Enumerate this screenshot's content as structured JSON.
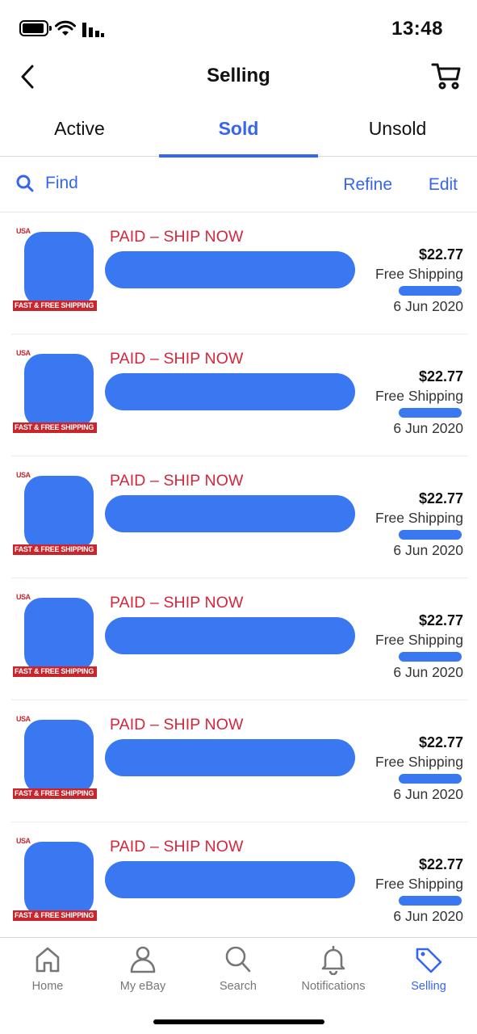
{
  "status_bar": {
    "time": "13:48"
  },
  "nav": {
    "title": "Selling"
  },
  "tabs": [
    {
      "label": "Active",
      "active": false
    },
    {
      "label": "Sold",
      "active": true
    },
    {
      "label": "Unsold",
      "active": false
    }
  ],
  "toolbar": {
    "find_label": "Find",
    "refine_label": "Refine",
    "edit_label": "Edit"
  },
  "items": [
    {
      "status": "PAID – SHIP NOW",
      "price": "$22.77",
      "shipping": "Free Shipping",
      "date": "6 Jun 2020",
      "badge_top": "USA",
      "badge_bottom": "FAST & FREE SHIPPING"
    },
    {
      "status": "PAID – SHIP NOW",
      "price": "$22.77",
      "shipping": "Free Shipping",
      "date": "6 Jun 2020",
      "badge_top": "USA",
      "badge_bottom": "FAST & FREE SHIPPING"
    },
    {
      "status": "PAID – SHIP NOW",
      "price": "$22.77",
      "shipping": "Free Shipping",
      "date": "6 Jun 2020",
      "badge_top": "USA",
      "badge_bottom": "FAST & FREE SHIPPING"
    },
    {
      "status": "PAID – SHIP NOW",
      "price": "$22.77",
      "shipping": "Free Shipping",
      "date": "6 Jun 2020",
      "badge_top": "USA",
      "badge_bottom": "FAST & FREE SHIPPING"
    },
    {
      "status": "PAID – SHIP NOW",
      "price": "$22.77",
      "shipping": "Free Shipping",
      "date": "6 Jun 2020",
      "badge_top": "USA",
      "badge_bottom": "FAST & FREE SHIPPING"
    },
    {
      "status": "PAID – SHIP NOW",
      "price": "$22.77",
      "shipping": "Free Shipping",
      "date": "6 Jun 2020",
      "badge_top": "USA",
      "badge_bottom": "FAST & FREE SHIPPING"
    }
  ],
  "bottom_nav": [
    {
      "label": "Home",
      "icon": "home-icon",
      "active": false
    },
    {
      "label": "My eBay",
      "icon": "person-icon",
      "active": false
    },
    {
      "label": "Search",
      "icon": "search-icon",
      "active": false
    },
    {
      "label": "Notifications",
      "icon": "bell-icon",
      "active": false
    },
    {
      "label": "Selling",
      "icon": "tag-icon",
      "active": true
    }
  ],
  "colors": {
    "accent": "#3665f3",
    "status_red": "#d6263b",
    "redaction_blue": "#3a78f2"
  }
}
